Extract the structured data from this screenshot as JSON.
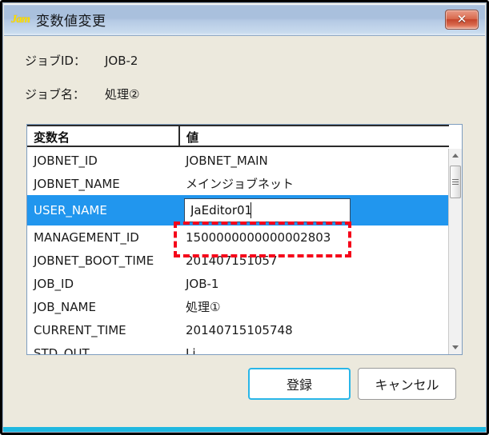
{
  "window": {
    "title": "変数値変更",
    "app_icon_text": "Jam",
    "close_label": "✕",
    "accent_color": "#29b6e8",
    "selection_color": "#2196ee",
    "annotation_color": "#f5051a"
  },
  "fields": [
    {
      "label": "ジョブID：",
      "value": "JOB-2"
    },
    {
      "label": "ジョブ名：",
      "value": "処理②"
    }
  ],
  "table": {
    "headers": {
      "name": "変数名",
      "value": "値"
    },
    "rows": [
      {
        "name": "JOBNET_ID",
        "value": "JOBNET_MAIN"
      },
      {
        "name": "JOBNET_NAME",
        "value": "メインジョブネット"
      },
      {
        "name": "USER_NAME",
        "value": "JaEditor01",
        "selected": true,
        "editing": true
      },
      {
        "name": "MANAGEMENT_ID",
        "value": "1500000000000002803"
      },
      {
        "name": "JOBNET_BOOT_TIME",
        "value": "201407151057"
      },
      {
        "name": "JOB_ID",
        "value": "JOB-1"
      },
      {
        "name": "JOB_NAME",
        "value": "処理①"
      },
      {
        "name": "CURRENT_TIME",
        "value": "20140715105748"
      },
      {
        "name": "STD_OUT",
        "value": "Li"
      }
    ]
  },
  "editor": {
    "value": "JaEditor01",
    "placeholder": ""
  },
  "scrollbar": {
    "up_icon": "triangle-up",
    "down_icon": "triangle-down"
  },
  "buttons": {
    "register": "登録",
    "cancel": "キャンセル"
  }
}
